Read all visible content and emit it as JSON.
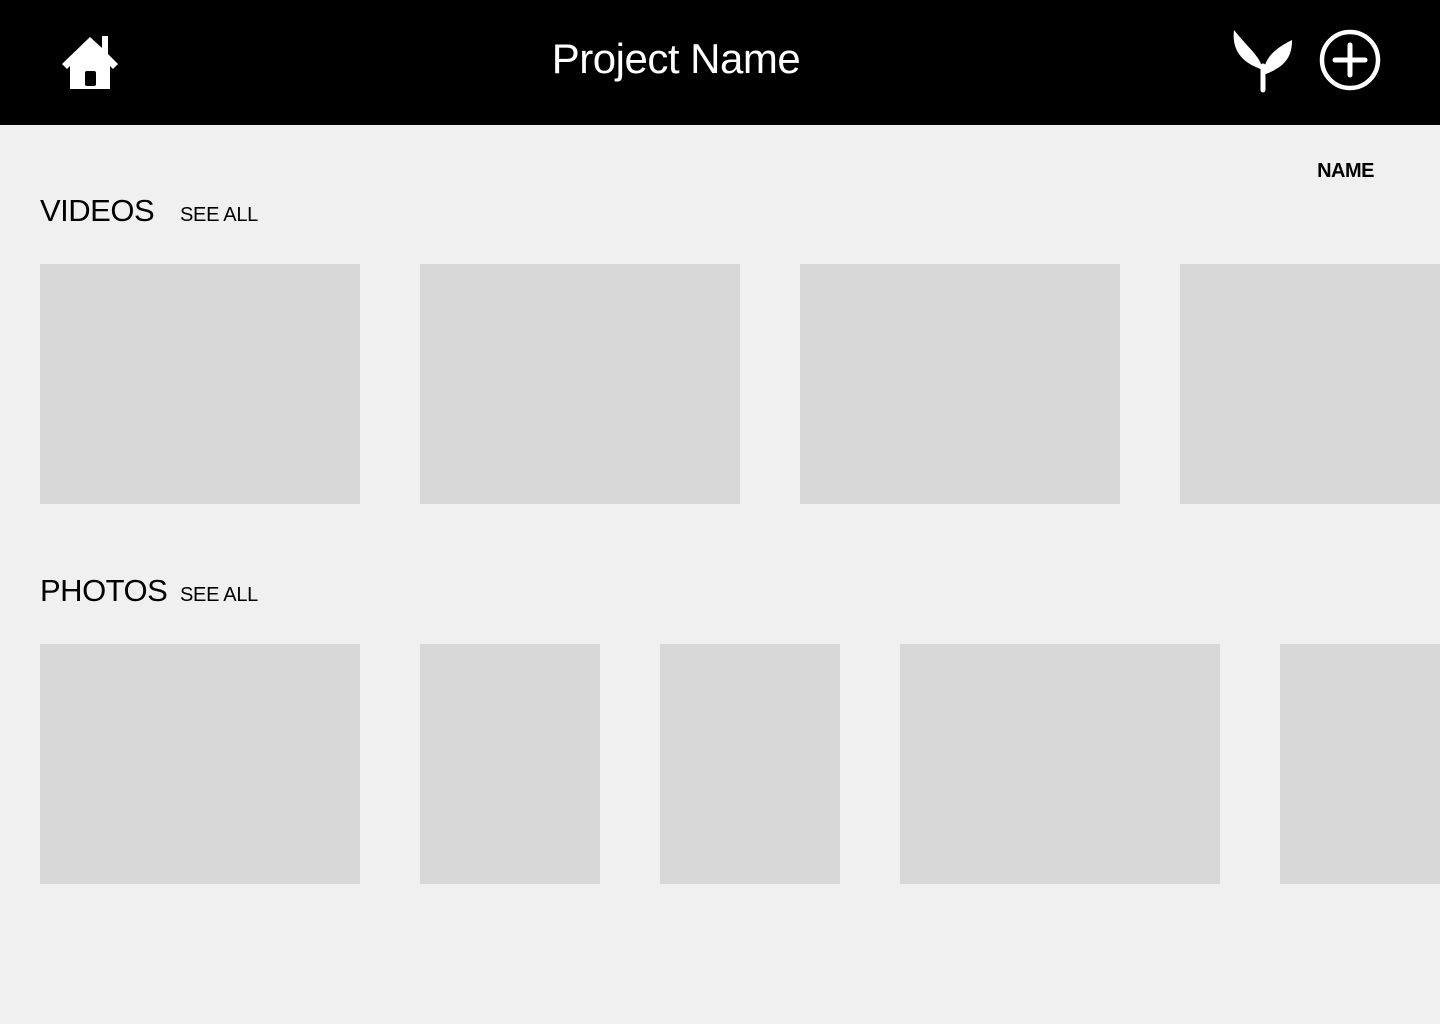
{
  "header": {
    "title": "Project Name",
    "icons": {
      "home": "home-icon",
      "sprout": "sprout-icon",
      "add": "plus-circle-icon"
    }
  },
  "sort": {
    "label": "NAME"
  },
  "videos": {
    "title": "VIDEOS",
    "see_all": "SEE ALL",
    "item_count": 4
  },
  "photos": {
    "title": "PHOTOS",
    "see_all": "SEE ALL",
    "item_count": 5
  },
  "colors": {
    "header_bg": "#000000",
    "page_bg": "#f0f0f0",
    "placeholder": "#d8d8d8",
    "text": "#000000",
    "header_text": "#ffffff"
  }
}
